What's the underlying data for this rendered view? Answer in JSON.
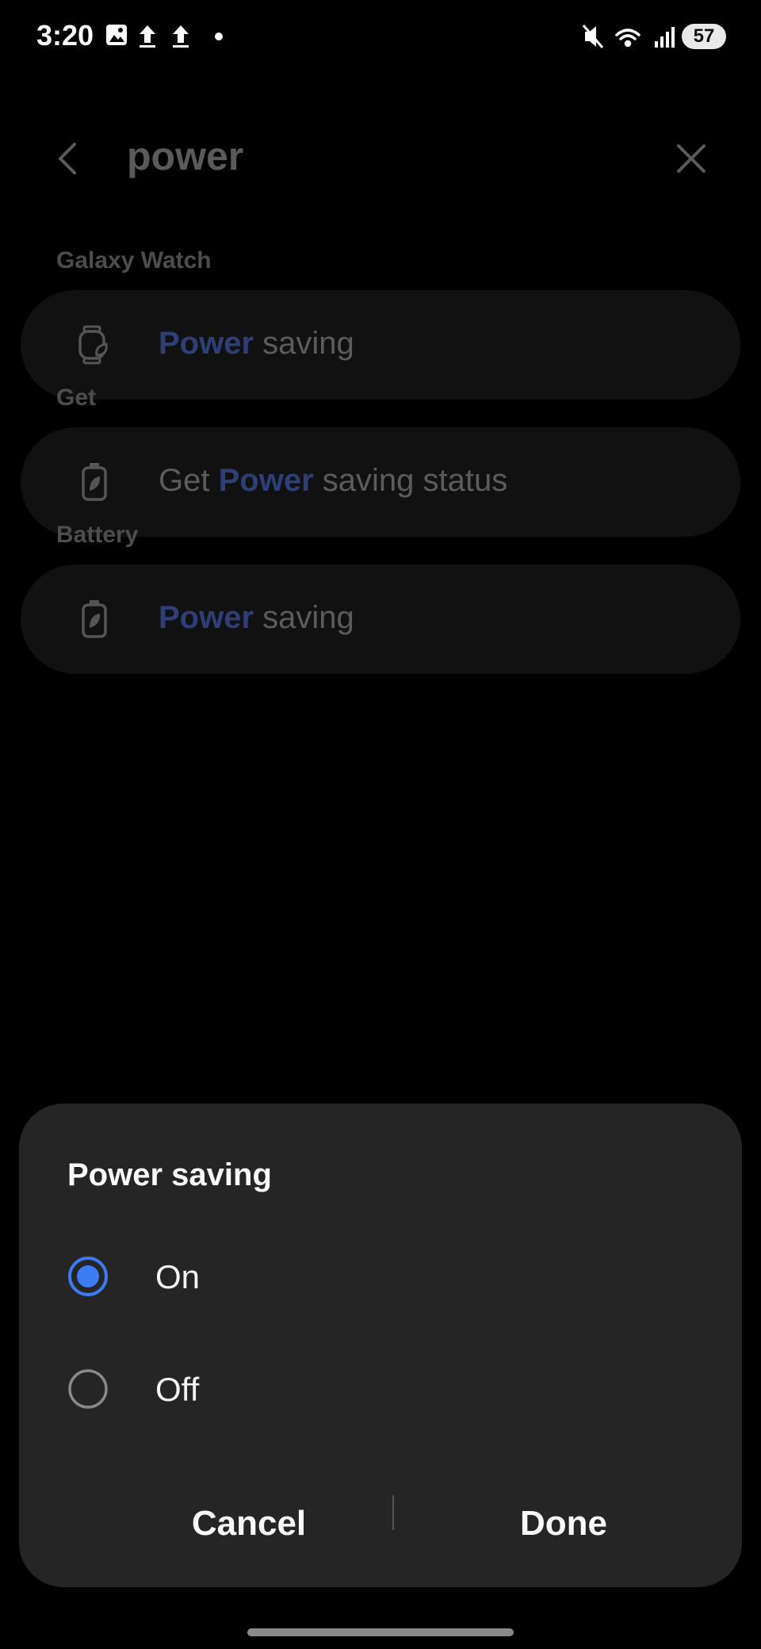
{
  "status_bar": {
    "time": "3:20",
    "battery": "57",
    "left_icons": [
      "image-icon",
      "upload-icon",
      "upload-icon",
      "dot-icon"
    ],
    "right_icons": [
      "mute-icon",
      "wifi-icon",
      "signal-icon",
      "battery-icon"
    ]
  },
  "search": {
    "query": "power",
    "back_icon": "back-arrow-icon",
    "close_icon": "close-icon"
  },
  "results": [
    {
      "section": "Galaxy Watch",
      "icon": "watch-icon",
      "prefix": "",
      "highlight": "Power",
      "suffix": " saving"
    },
    {
      "section": "Get",
      "icon": "battery-leaf-icon",
      "prefix": "Get ",
      "highlight": "Power",
      "suffix": " saving status"
    },
    {
      "section": "Battery",
      "icon": "battery-leaf-icon",
      "prefix": "",
      "highlight": "Power",
      "suffix": " saving"
    }
  ],
  "dialog": {
    "title": "Power saving",
    "options": [
      {
        "label": "On",
        "selected": true
      },
      {
        "label": "Off",
        "selected": false
      }
    ],
    "cancel_label": "Cancel",
    "done_label": "Done"
  },
  "colors": {
    "accent": "#3d7bf5",
    "highlight_dim": "#2e3f77",
    "dialog_bg": "#252525"
  }
}
